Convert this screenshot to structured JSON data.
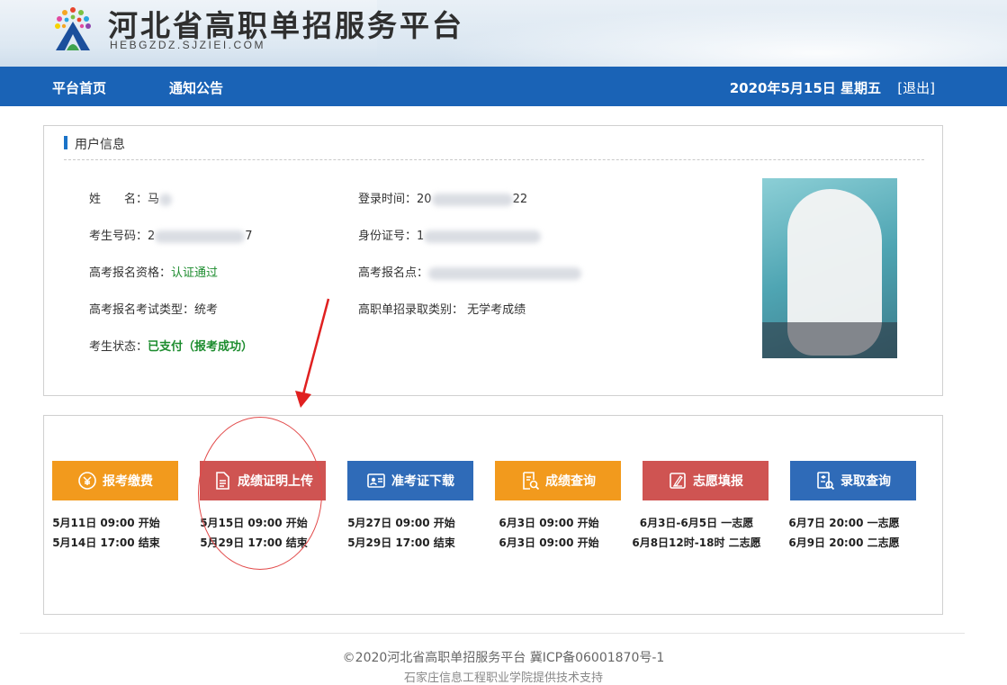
{
  "header": {
    "title": "河北省高职单招服务平台",
    "url": "HEBGZDZ.SJZIEI.COM"
  },
  "nav": {
    "home": "平台首页",
    "notice": "通知公告",
    "date": "2020年5月15日 星期五",
    "logout": "[退出]"
  },
  "user_info": {
    "title": "用户信息",
    "name_label": "姓　　名：",
    "name_value": "马",
    "login_label": "登录时间：",
    "login_value": "20",
    "login_tail": "22",
    "exam_no_label": "考生号码：",
    "exam_no_value": "2",
    "exam_no_tail": "7",
    "id_label": "身份证号：",
    "id_value": "1",
    "qual_label": "高考报名资格：",
    "qual_value": "认证通过",
    "site_label": "高考报名点：",
    "type_label": "高考报名考试类型：",
    "type_value": "统考",
    "category_label": "高职单招录取类别：",
    "category_value": "无学考成绩",
    "status_label": "考生状态：",
    "status_value": "已支付（报考成功）"
  },
  "services": [
    {
      "label": "报考缴费",
      "icon": "payment-icon",
      "line1": "5月11日 09:00 开始",
      "line2": "5月14日 17:00 结束",
      "color": "#f29a1d"
    },
    {
      "label": "成绩证明上传",
      "icon": "document-icon",
      "line1": "5月15日 09:00 开始",
      "line2": "5月29日 17:00 结束",
      "color": "#cf5452"
    },
    {
      "label": "准考证下载",
      "icon": "id-card-icon",
      "line1": "5月27日 09:00 开始",
      "line2": "5月29日 17:00 结束",
      "color": "#2f6bb8"
    },
    {
      "label": "成绩查询",
      "icon": "report-search-icon",
      "line1": "6月3日 09:00 开始",
      "line2": "6月3日 09:00 开始",
      "color": "#f29a1d"
    },
    {
      "label": "志愿填报",
      "icon": "edit-icon",
      "line1": "6月3日-6月5日 一志愿",
      "line2": "6月8日12时-18时 二志愿",
      "color": "#cf5452"
    },
    {
      "label": "录取查询",
      "icon": "admission-search-icon",
      "line1": "6月7日 20:00 一志愿",
      "line2": "6月9日 20:00 二志愿",
      "color": "#2f6bb8"
    }
  ],
  "footer": {
    "copyright": "©2020河北省高职单招服务平台  冀ICP备06001870号-1",
    "tech": "石家庄信息工程职业学院提供技术支持"
  }
}
